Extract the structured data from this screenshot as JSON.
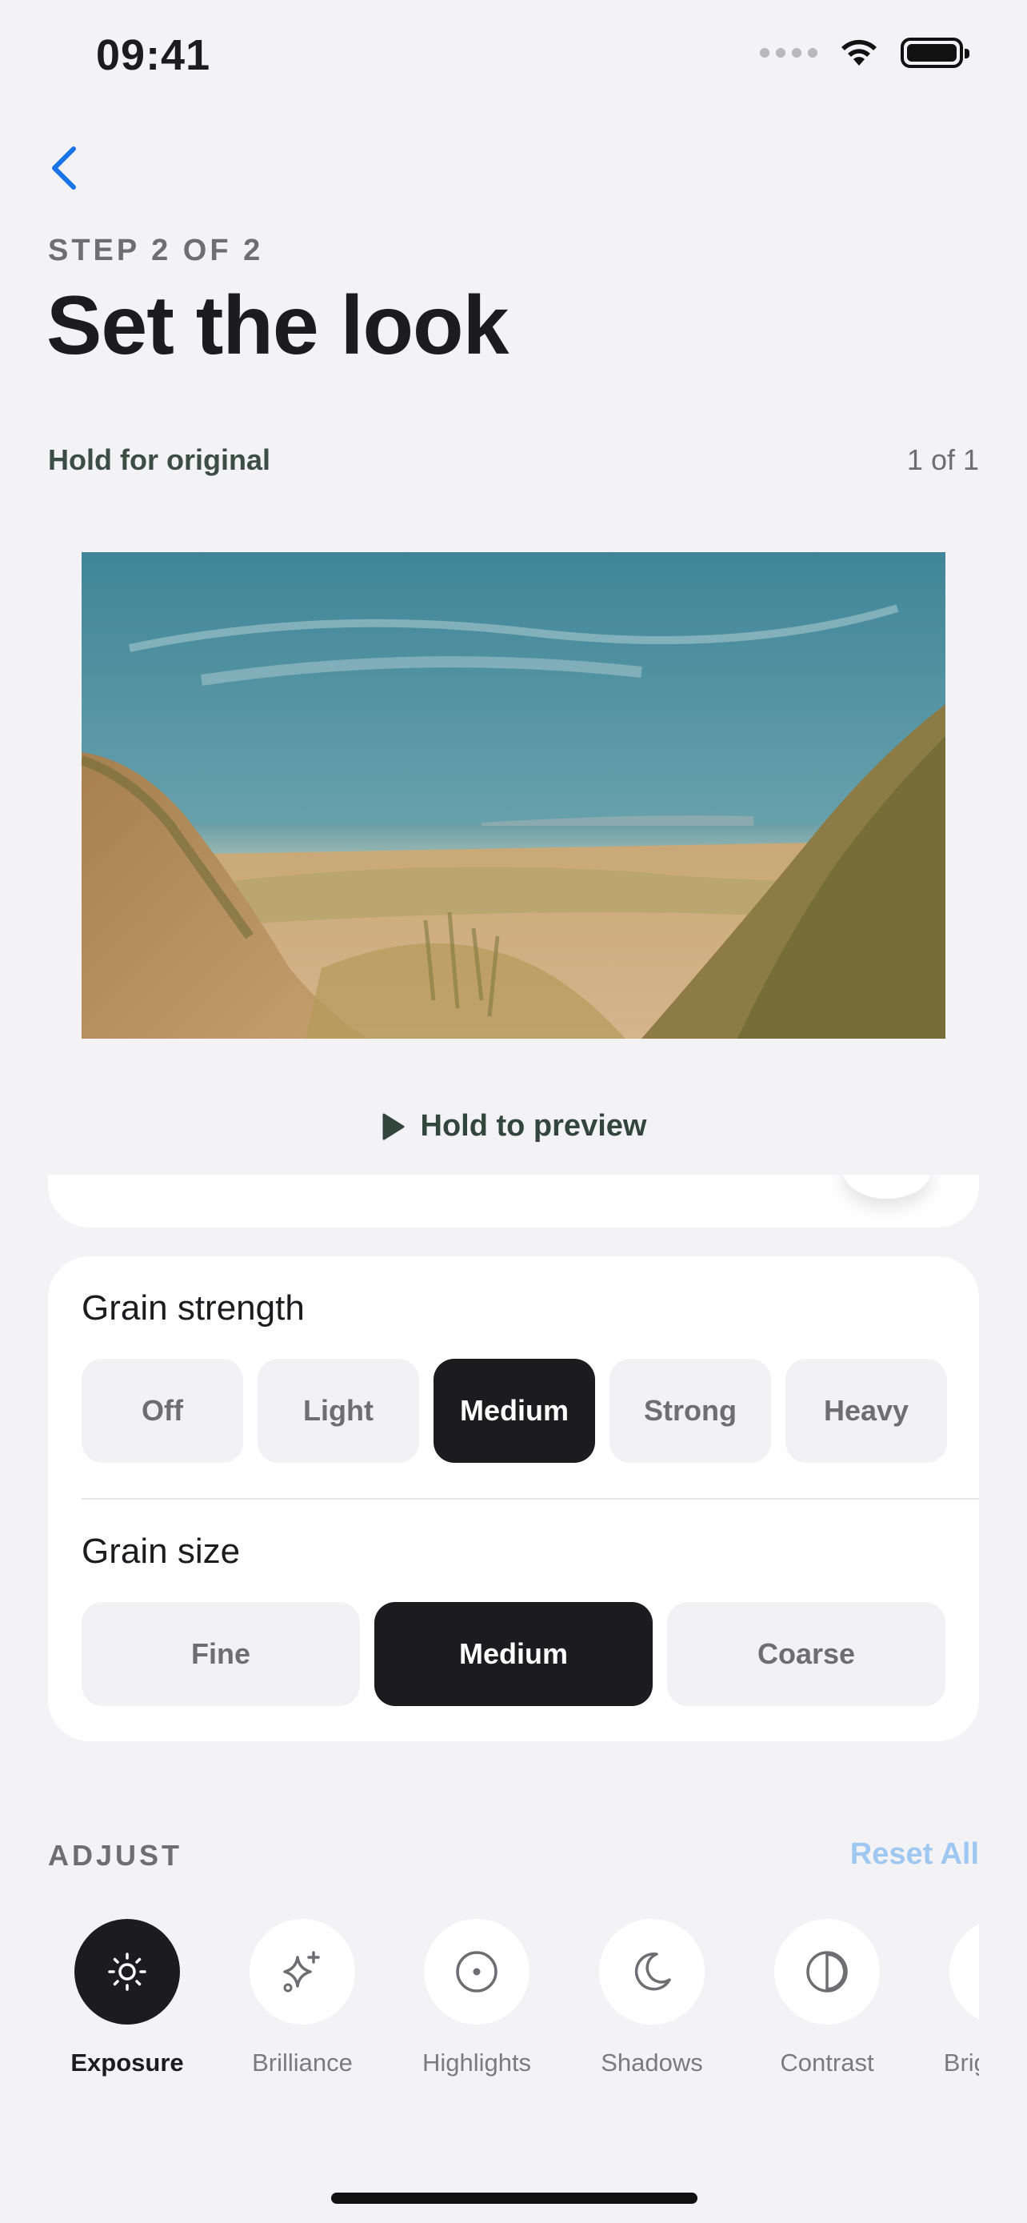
{
  "status_bar": {
    "time": "09:41"
  },
  "header": {
    "step_label": "STEP 2 OF 2",
    "title": "Set the look"
  },
  "preview": {
    "hold_original_label": "Hold for original",
    "counter": "1 of 1",
    "hold_to_preview_label": "Hold to preview"
  },
  "grain": {
    "strength_title": "Grain strength",
    "strength_options": [
      "Off",
      "Light",
      "Medium",
      "Strong",
      "Heavy"
    ],
    "strength_selected": "Medium",
    "size_title": "Grain size",
    "size_options": [
      "Fine",
      "Medium",
      "Coarse"
    ],
    "size_selected": "Medium"
  },
  "adjust": {
    "label": "ADJUST",
    "reset_label": "Reset All",
    "tools": [
      {
        "label": "Exposure",
        "icon": "sun-icon",
        "active": true
      },
      {
        "label": "Brilliance",
        "icon": "sparkles-icon",
        "active": false
      },
      {
        "label": "Highlights",
        "icon": "target-icon",
        "active": false
      },
      {
        "label": "Shadows",
        "icon": "moon-icon",
        "active": false
      },
      {
        "label": "Contrast",
        "icon": "contrast-icon",
        "active": false
      },
      {
        "label": "Brightness",
        "icon": "brightness-icon",
        "active": false
      }
    ]
  },
  "colors": {
    "accent": "#1c1c1e",
    "link": "#9ec7f2",
    "back_chevron": "#1a73e8",
    "background": "#f3f3f6"
  }
}
